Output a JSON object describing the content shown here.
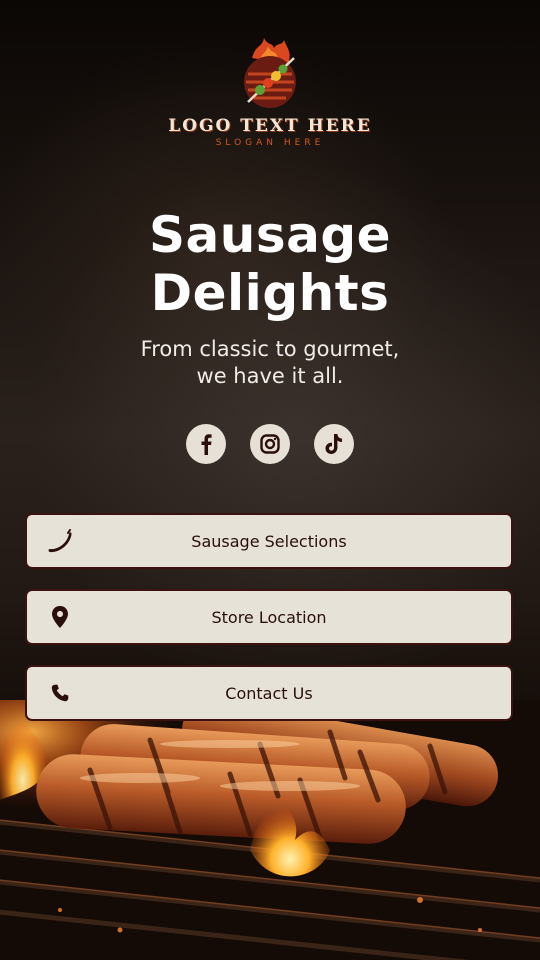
{
  "logo": {
    "name": "LOGO TEXT HERE",
    "slogan": "SLOGAN HERE"
  },
  "hero": {
    "title_line1": "Sausage",
    "title_line2": "Delights",
    "subtitle_line1": "From classic to gourmet,",
    "subtitle_line2": "we have it all."
  },
  "socials": [
    {
      "icon": "facebook-icon"
    },
    {
      "icon": "instagram-icon"
    },
    {
      "icon": "tiktok-icon"
    }
  ],
  "buttons": [
    {
      "label": "Sausage Selections",
      "icon": "sausage-icon"
    },
    {
      "label": "Store Location",
      "icon": "location-pin-icon"
    },
    {
      "label": "Contact Us",
      "icon": "phone-icon"
    }
  ],
  "colors": {
    "button_bg": "#e6e2d8",
    "button_border": "#3a1210",
    "button_text": "#2a0f0c",
    "slogan": "#d25a1f"
  }
}
